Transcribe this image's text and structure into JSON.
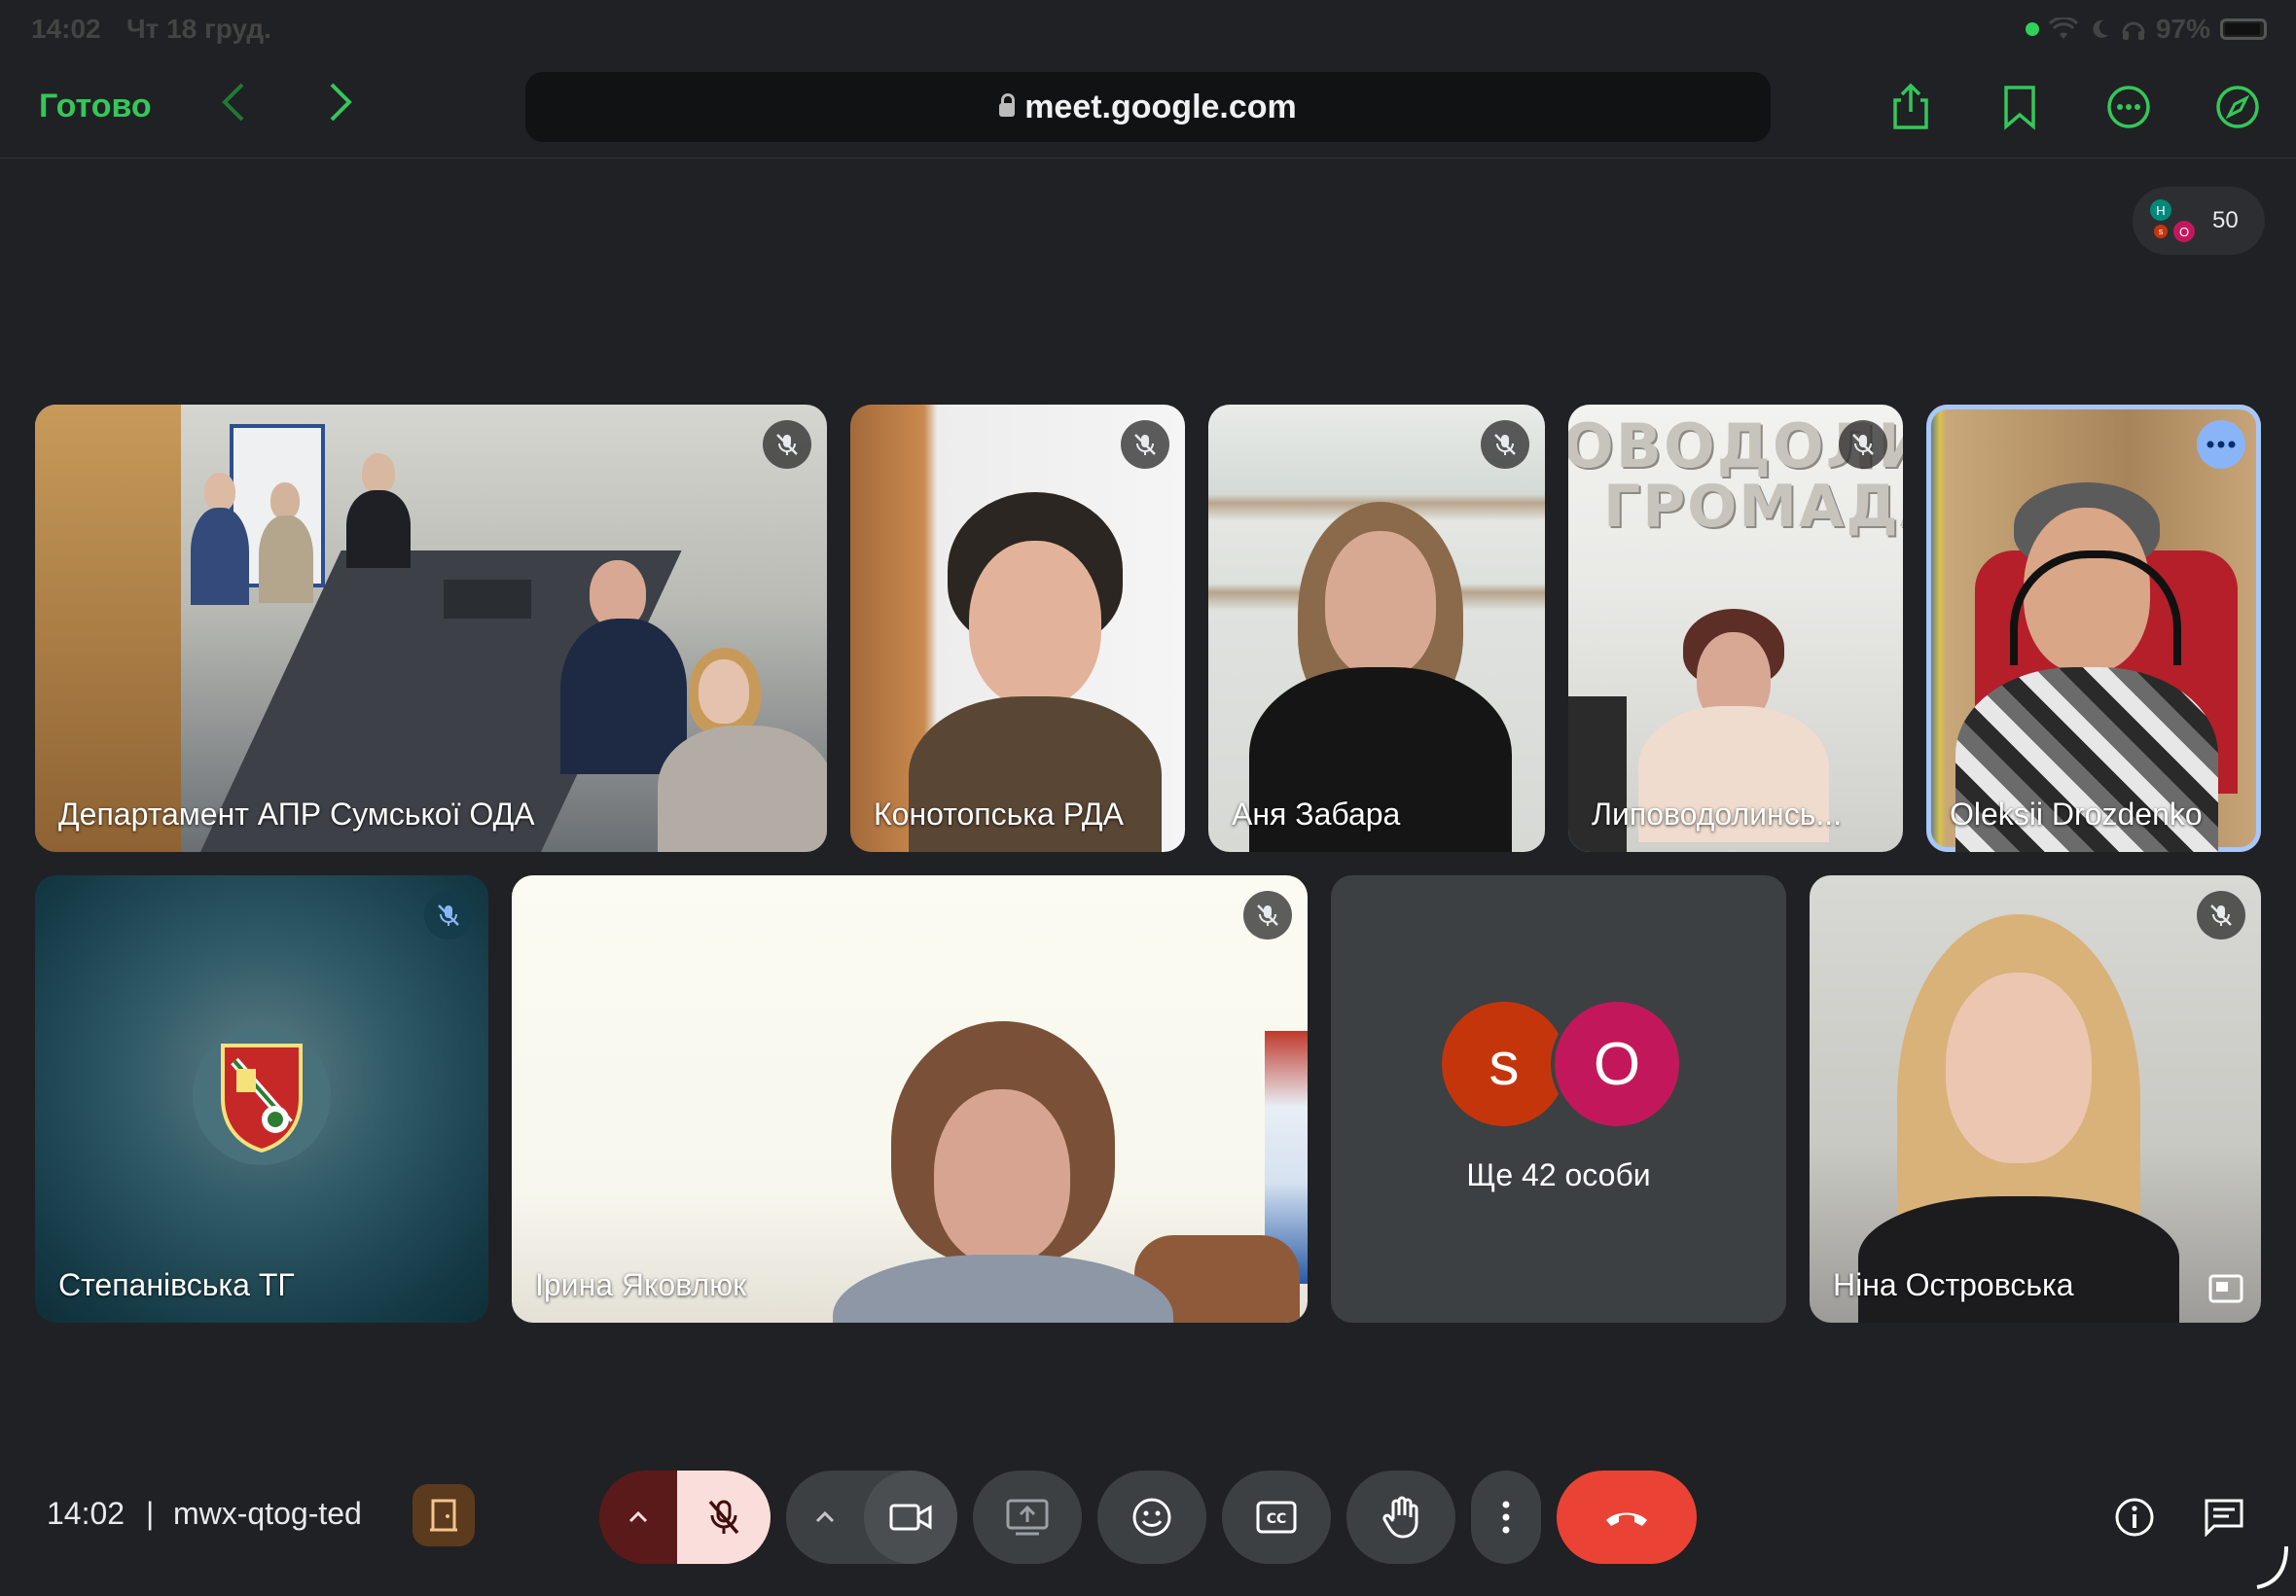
{
  "status_bar": {
    "time": "14:02",
    "date": "Чт 18 груд.",
    "battery": "97%"
  },
  "browser": {
    "done_label": "Готово",
    "url": "meet.google.com"
  },
  "participants_badge": {
    "count": "50",
    "mini_avatars": [
      "Н",
      "О",
      "s"
    ]
  },
  "tiles": [
    {
      "name": "Департамент АПР Сумської ОДА",
      "muted": true
    },
    {
      "name": "Конотопська РДА",
      "muted": true
    },
    {
      "name": "Аня Забара",
      "muted": true
    },
    {
      "name": "Липоводолинсь...",
      "muted": true,
      "sign_line1": "ОВОДОЛИ",
      "sign_line2": "ГРОМАДА"
    },
    {
      "name": "Oleksii Drozdenko",
      "muted": false
    },
    {
      "name": "Степанівська ТГ",
      "muted": true
    },
    {
      "name": "Ірина Яковлюк",
      "muted": true
    },
    {
      "name": "Ще 42 особи",
      "avatars": [
        "s",
        "O"
      ]
    },
    {
      "name": "Ніна Островська",
      "muted": true
    }
  ],
  "bottom_bar": {
    "time": "14:02",
    "separator": "|",
    "meeting_code": "mwx-qtog-ted"
  },
  "colors": {
    "accent_green": "#34c759",
    "end_call": "#ea4335",
    "mic_off_bg": "#f9dedc",
    "avatar_s": "#c5350b",
    "avatar_o": "#c2185b"
  }
}
